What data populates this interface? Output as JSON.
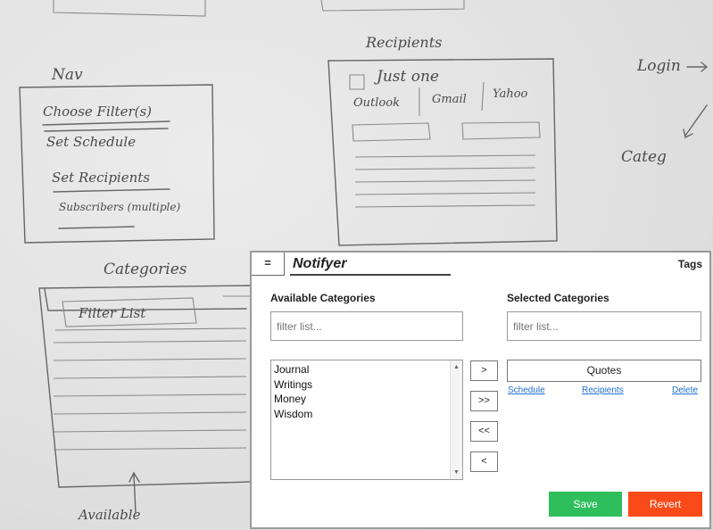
{
  "sketch": {
    "nav_title": "Nav",
    "nav_items": [
      "Choose Filter(s)",
      "Set Schedule",
      "Set Recipients",
      "Subscribers (multiple)"
    ],
    "recipients_title": "Recipients",
    "just_one_label": "Just one",
    "provider_labels": [
      "Outlook",
      "Gmail",
      "Yahoo"
    ],
    "login_label": "Login",
    "categ_label": "Categ",
    "categories_title": "Categories",
    "filter_list_label": "Filter List",
    "available_label": "Available"
  },
  "app": {
    "menu_label": "=",
    "title": "Notifyer",
    "tags_label": "Tags",
    "available_heading": "Available Categories",
    "selected_heading": "Selected Categories",
    "available_filter_placeholder": "filter list...",
    "selected_filter_placeholder": "filter list...",
    "available_items": [
      "Journal",
      "Writings",
      "Money",
      "Wisdom"
    ],
    "move_buttons": {
      "add_one": ">",
      "add_all": ">>",
      "remove_all": "<<",
      "remove_one": "<"
    },
    "selected_items": [
      "Quotes"
    ],
    "item_links": {
      "schedule": "Schedule",
      "recipients": "Recipients",
      "delete": "Delete"
    },
    "save_label": "Save",
    "revert_label": "Revert",
    "colors": {
      "save": "#2ebe5c",
      "revert": "#fb4a1a",
      "link": "#1f6fd1"
    }
  }
}
